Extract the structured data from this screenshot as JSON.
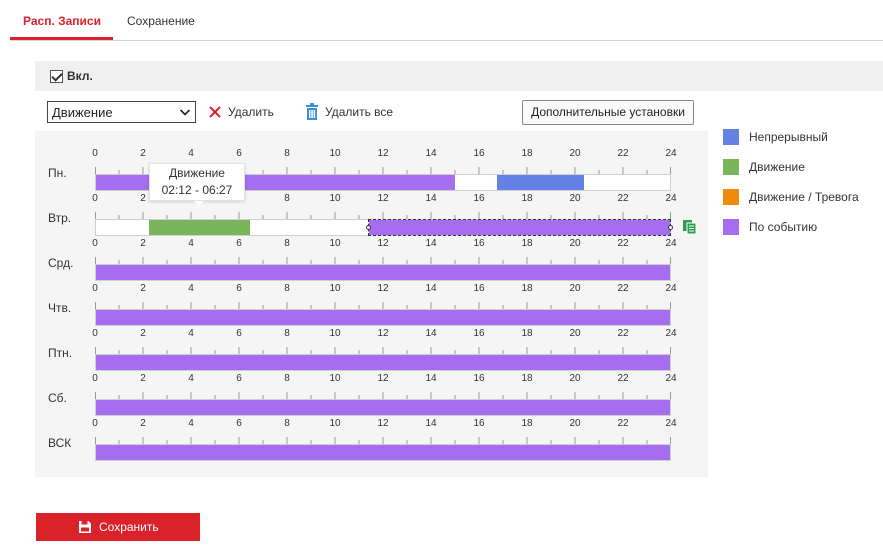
{
  "tabs": [
    {
      "label": "Расп. Записи",
      "active": true
    },
    {
      "label": "Сохранение",
      "active": false
    }
  ],
  "enable": {
    "label": "Вкл.",
    "checked": true
  },
  "toolbar": {
    "record_type_selected": "Движение",
    "delete_label": "Удалить",
    "delete_all_label": "Удалить все",
    "advanced_label": "Дополнительные установки"
  },
  "tick_labels": [
    "0",
    "2",
    "4",
    "6",
    "8",
    "10",
    "12",
    "14",
    "16",
    "18",
    "20",
    "22",
    "24"
  ],
  "record_types": {
    "continuous": {
      "label": "Непрерывный",
      "color": "#6681e6"
    },
    "motion": {
      "label": "Движение",
      "color": "#7ab55c"
    },
    "alarm": {
      "label": "Движение / Тревога",
      "color": "#ee8c0a"
    },
    "event": {
      "label": "По событию",
      "color": "#a56ef0"
    }
  },
  "days": [
    {
      "label": "Пн.",
      "segments": [
        {
          "type": "event",
          "start": 0,
          "end": 15
        },
        {
          "type": "continuous",
          "start": 16.75,
          "end": 20.4
        }
      ]
    },
    {
      "label": "Втр.",
      "selected": true,
      "segments": [
        {
          "type": "motion",
          "start": 2.2,
          "end": 6.45
        },
        {
          "type": "event",
          "start": 11.4,
          "end": 24,
          "selected": true
        }
      ]
    },
    {
      "label": "Срд.",
      "segments": [
        {
          "type": "event",
          "start": 0,
          "end": 24
        }
      ]
    },
    {
      "label": "Чтв.",
      "segments": [
        {
          "type": "event",
          "start": 0,
          "end": 24
        }
      ]
    },
    {
      "label": "Птн.",
      "segments": [
        {
          "type": "event",
          "start": 0,
          "end": 24
        }
      ]
    },
    {
      "label": "Сб.",
      "segments": [
        {
          "type": "event",
          "start": 0,
          "end": 24
        }
      ]
    },
    {
      "label": "ВСК",
      "segments": [
        {
          "type": "event",
          "start": 0,
          "end": 24
        }
      ]
    }
  ],
  "tooltip": {
    "title": "Движение",
    "range": "02:12 - 06:27"
  },
  "save_label": "Сохранить",
  "accent_color": "#d9222a"
}
